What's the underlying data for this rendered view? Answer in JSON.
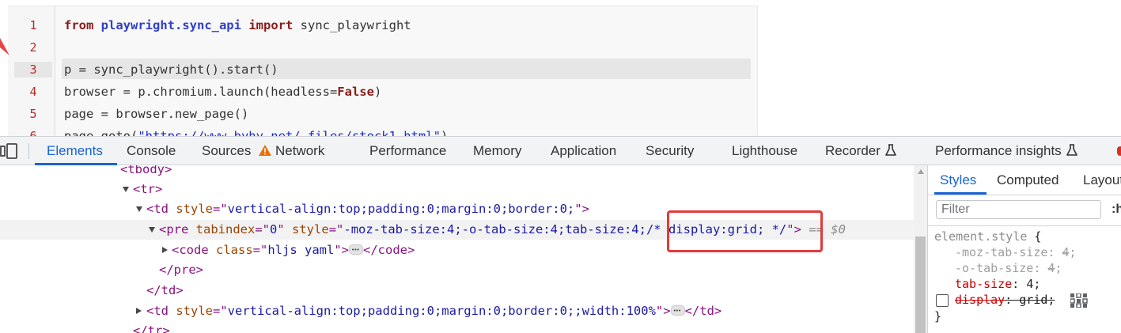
{
  "code": {
    "line_numbers": [
      "1",
      "2",
      "3",
      "4",
      "5",
      "6"
    ],
    "active_line": "3",
    "lines": [
      [
        {
          "t": "from",
          "c": "kw"
        },
        {
          "t": " "
        },
        {
          "t": "playwright.sync_api",
          "c": "mod"
        },
        {
          "t": " "
        },
        {
          "t": "import",
          "c": "kw"
        },
        {
          "t": " sync_playwright"
        }
      ],
      [],
      [
        {
          "t": "p = sync_playwright().start()"
        }
      ],
      [
        {
          "t": "browser = p.chromium.launch(headless="
        },
        {
          "t": "False",
          "c": "kw"
        },
        {
          "t": ")"
        }
      ],
      [
        {
          "t": "page = browser.new_page()"
        }
      ],
      [
        {
          "t": "page.goto("
        },
        {
          "t": "\"https://www.byhy.net/_files/stock1.html\"",
          "c": "str"
        },
        {
          "t": ")"
        }
      ]
    ]
  },
  "devtools": {
    "tabs": [
      {
        "label": "Elements",
        "active": true
      },
      {
        "label": "Console"
      },
      {
        "label": "Sources"
      },
      {
        "label": "Network",
        "icon": "warning-icon"
      },
      {
        "label": "Performance"
      },
      {
        "label": "Memory"
      },
      {
        "label": "Application"
      },
      {
        "label": "Security"
      },
      {
        "label": "Lighthouse"
      },
      {
        "label": "Recorder",
        "icon": "flask-icon"
      },
      {
        "label": "Performance insights",
        "icon": "flask-icon"
      }
    ],
    "tree": [
      [
        {
          "t": "<tbody>",
          "c": "tg"
        }
      ],
      [
        {
          "t": "<tr>",
          "c": "tg"
        }
      ],
      [
        {
          "t": "<td",
          "c": "tg"
        },
        {
          "t": " style",
          "c": "an"
        },
        {
          "t": "=\"",
          "c": "eq"
        },
        {
          "t": "vertical-align:top;padding:0;margin:0;border:0;",
          "c": "av"
        },
        {
          "t": "\">",
          "c": "tg"
        }
      ],
      [
        {
          "t": "<pre",
          "c": "tg"
        },
        {
          "t": " tabindex",
          "c": "an"
        },
        {
          "t": "=\"",
          "c": "eq"
        },
        {
          "t": "0",
          "c": "av"
        },
        {
          "t": "\"",
          "c": "eq"
        },
        {
          "t": " style",
          "c": "an"
        },
        {
          "t": "=\"",
          "c": "eq"
        },
        {
          "t": "-moz-tab-size:4;-o-tab-size:4;tab-size:4;/* display:grid; */",
          "c": "av"
        },
        {
          "t": "\">",
          "c": "tg"
        },
        {
          "t": " == ",
          "c": "dollar"
        },
        {
          "t": "$0",
          "c": "dollar"
        }
      ],
      [
        {
          "t": "<code",
          "c": "tg"
        },
        {
          "t": " class",
          "c": "an"
        },
        {
          "t": "=\"",
          "c": "eq"
        },
        {
          "t": "hljs yaml",
          "c": "av"
        },
        {
          "t": "\">",
          "c": "tg"
        },
        {
          "t": "",
          "c": "ellipsis"
        },
        {
          "t": "</code>",
          "c": "tg"
        }
      ],
      [
        {
          "t": "</pre>",
          "c": "tg"
        }
      ],
      [
        {
          "t": "</td>",
          "c": "tg"
        }
      ],
      [
        {
          "t": "<td",
          "c": "tg"
        },
        {
          "t": " style",
          "c": "an"
        },
        {
          "t": "=\"",
          "c": "eq"
        },
        {
          "t": "vertical-align:top;padding:0;margin:0;border:0;;width:100%",
          "c": "av"
        },
        {
          "t": "\">",
          "c": "tg"
        },
        {
          "t": "",
          "c": "ellipsis"
        },
        {
          "t": "</td>",
          "c": "tg"
        }
      ],
      [
        {
          "t": "</tr>",
          "c": "tg"
        }
      ]
    ],
    "styles_pane": {
      "tabs": [
        "Styles",
        "Computed",
        "Layout"
      ],
      "filter_placeholder": "Filter",
      "hov_label": ":h",
      "selector": "element.style",
      "open_brace": " {",
      "close_brace": "}",
      "rules": [
        {
          "name": "-moz-tab-size",
          "value": "4",
          "state": "invalid"
        },
        {
          "name": "-o-tab-size",
          "value": "4",
          "state": "invalid"
        },
        {
          "name": "tab-size",
          "value": "4",
          "state": "active"
        },
        {
          "name": "display",
          "value": "grid",
          "state": "disabled"
        }
      ]
    }
  }
}
